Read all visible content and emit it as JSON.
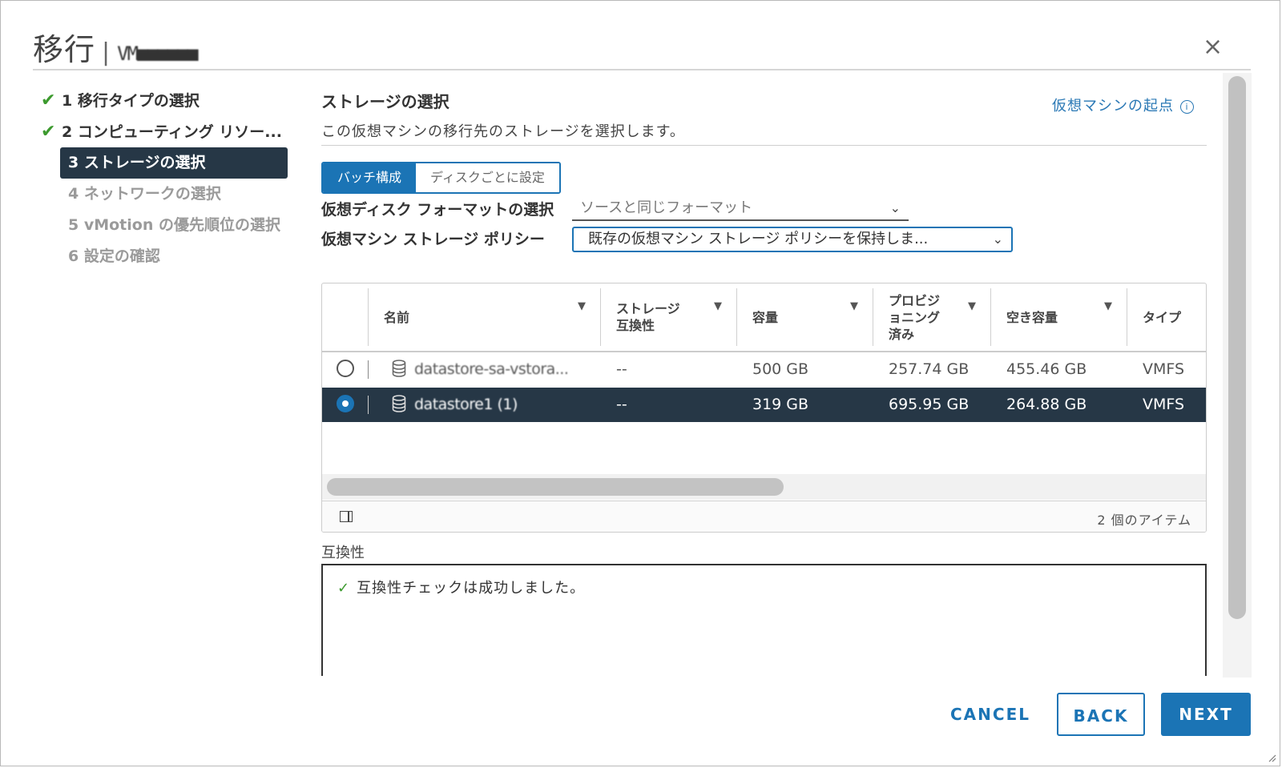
{
  "dialog": {
    "title": "移行",
    "vm_name": "VM■■■■■■",
    "close_label": "×"
  },
  "steps": [
    {
      "label": "1 移行タイプの選択",
      "state": "done"
    },
    {
      "label": "2 コンピューティング リソー...",
      "state": "done"
    },
    {
      "label": "3 ストレージの選択",
      "state": "active"
    },
    {
      "label": "4 ネットワークの選択",
      "state": "disabled"
    },
    {
      "label": "5 vMotion の優先順位の選択",
      "state": "disabled"
    },
    {
      "label": "6 設定の確認",
      "state": "disabled"
    }
  ],
  "content": {
    "title": "ストレージの選択",
    "subtitle": "この仮想マシンの移行先のストレージを選択します。",
    "origin_link": "仮想マシンの起点",
    "tabs": {
      "batch": "バッチ構成",
      "per_disk": "ディスクごとに設定"
    },
    "disk_format_label": "仮想ディスク フォーマットの選択",
    "disk_format_value": "ソースと同じフォーマット",
    "policy_label": "仮想マシン ストレージ ポリシー",
    "policy_value": "既存の仮想マシン ストレージ ポリシーを保持しま..."
  },
  "table": {
    "columns": [
      "名前",
      "ストレージ\n互換性",
      "容量",
      "プロビジ\nョニング\n済み",
      "空き容量",
      "タイプ"
    ],
    "rows": [
      {
        "name": "datastore-sa-vstora...",
        "compat": "--",
        "capacity": "500 GB",
        "provisioned": "257.74 GB",
        "free": "455.46 GB",
        "type": "VMFS",
        "selected": false
      },
      {
        "name": "datastore1 (1)",
        "compat": "--",
        "capacity": "319 GB",
        "provisioned": "695.95 GB",
        "free": "264.88 GB",
        "type": "VMFS",
        "selected": true
      }
    ],
    "item_count": "2 個のアイテム"
  },
  "compat": {
    "label": "互換性",
    "message": "互換性チェックは成功しました。"
  },
  "footer": {
    "cancel": "CANCEL",
    "back": "BACK",
    "next": "NEXT"
  },
  "colors": {
    "accent": "#1b74b5",
    "selected_row": "#263746",
    "success": "#3c9a2e"
  }
}
